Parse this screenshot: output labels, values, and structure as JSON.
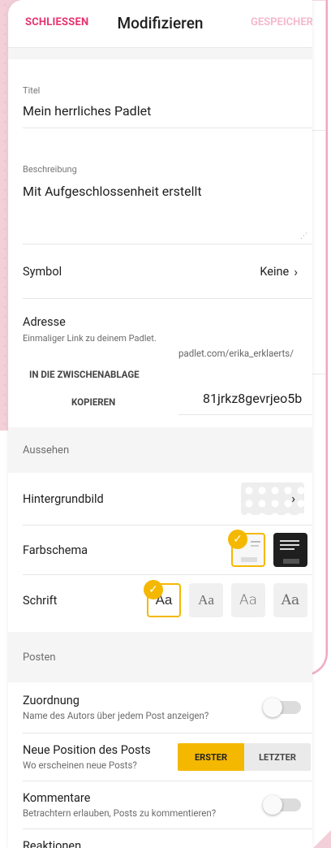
{
  "header": {
    "close_label": "SCHLIESSEN",
    "title": "Modifizieren",
    "save_label": "GESPEICHERT"
  },
  "form": {
    "title_label": "Titel",
    "title_value": "Mein herrliches Padlet",
    "description_label": "Beschreibung",
    "description_value": "Mit Aufgeschlossenheit erstellt",
    "symbol_label": "Symbol",
    "symbol_value": "Keine",
    "address_label": "Adresse",
    "address_hint": "Einmaliger Link zu deinem Padlet.",
    "address_prefix": "padlet.com/erika_erklaerts/",
    "clipboard_label": "IN DIE ZWISCHENABLAGE",
    "copy_label": "KOPIEREN",
    "address_slug": "81jrkz8gevrjeo5b"
  },
  "appearance": {
    "section_label": "Aussehen",
    "background_label": "Hintergrundbild",
    "color_scheme_label": "Farbschema",
    "font_label": "Schrift",
    "font_options": [
      "Aa",
      "Aa",
      "Aa",
      "Aa"
    ],
    "selected_font_index": 0,
    "selected_color_scheme": "light"
  },
  "posting": {
    "section_label": "Posten",
    "attribution_label": "Zuordnung",
    "attribution_desc": "Name des Autors über jedem Post anzeigen?",
    "attribution_on": false,
    "new_position_label": "Neue Position des Posts",
    "new_position_desc": "Wo erscheinen neue Posts?",
    "position_first": "ERSTER",
    "position_last": "LETZTER",
    "position_selected": "ERSTER",
    "comments_label": "Kommentare",
    "comments_desc": "Betrachtern erlauben, Posts zu kommentieren?",
    "comments_on": false,
    "reactions_label": "Reaktionen"
  },
  "colors": {
    "accent_pink": "#e5326f",
    "accent_yellow": "#f5b800"
  },
  "icons": {
    "chevron": "chevron-right-icon",
    "check": "check-icon",
    "resize": "resize-handle-icon"
  }
}
